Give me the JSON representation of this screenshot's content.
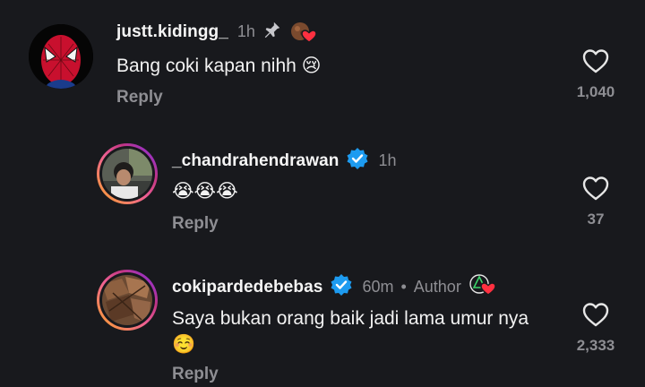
{
  "comments": [
    {
      "username": "justt.kidingg_",
      "time": "1h",
      "text": "Bang coki kapan nihh",
      "text_emoji": "😢",
      "reply_label": "Reply",
      "likes": "1,040",
      "pinned": true,
      "liked_by_creator": true,
      "avatar": "spiderman-avatar"
    },
    {
      "username": "_chandrahendrawan",
      "verified": true,
      "time": "1h",
      "text_emoji": "😭😭😭",
      "reply_label": "Reply",
      "likes": "37",
      "avatar": "photo-avatar"
    },
    {
      "username": "cokipardedebebas",
      "verified": true,
      "time": "60m",
      "separator": "•",
      "author_label": "Author",
      "text": "Saya bukan orang baik jadi lama umur nya",
      "text_emoji": "☺️",
      "reply_label": "Reply",
      "likes": "2,333",
      "liked_by_creator": true,
      "avatar": "food-avatar"
    }
  ],
  "colors": {
    "background": "#18191d",
    "muted": "#8e8e93",
    "verified": "#1d9bf0",
    "like_heart": "#ff3040"
  }
}
